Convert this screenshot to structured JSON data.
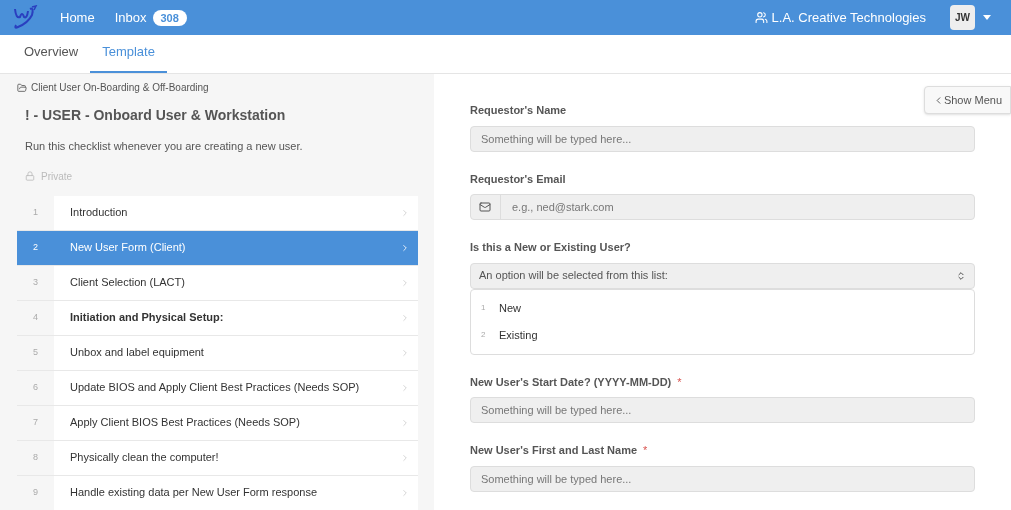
{
  "nav": {
    "links": [
      {
        "label": "Home"
      },
      {
        "label": "Inbox",
        "badge": "308"
      }
    ],
    "org": "L.A. Creative Technologies",
    "avatar": "JW"
  },
  "tabs": [
    {
      "label": "Overview",
      "selected": false
    },
    {
      "label": "Template",
      "selected": true
    }
  ],
  "breadcrumb": "Client User On-Boarding & Off-Boarding",
  "title": "! - USER - Onboard User & Workstation",
  "description": "Run this checklist whenever you are creating a new user.",
  "visibility": "Private",
  "tasks": [
    {
      "number": "1",
      "label": "Introduction",
      "selected": false,
      "heading": false
    },
    {
      "number": "2",
      "label": "New User Form (Client)",
      "selected": true,
      "heading": false
    },
    {
      "number": "3",
      "label": "Client Selection (LACT)",
      "selected": false,
      "heading": false
    },
    {
      "number": "4",
      "label": "Initiation and Physical Setup:",
      "selected": false,
      "heading": true
    },
    {
      "number": "5",
      "label": "Unbox and label equipment",
      "selected": false,
      "heading": false
    },
    {
      "number": "6",
      "label": "Update BIOS and Apply Client Best Practices (Needs SOP)",
      "selected": false,
      "heading": false
    },
    {
      "number": "7",
      "label": "Apply Client BIOS Best Practices (Needs SOP)",
      "selected": false,
      "heading": false
    },
    {
      "number": "8",
      "label": "Physically clean the computer!",
      "selected": false,
      "heading": false
    },
    {
      "number": "9",
      "label": "Handle existing data per New User Form response",
      "selected": false,
      "heading": false
    }
  ],
  "show_menu": "Show Menu",
  "required_mark": "*",
  "form": [
    {
      "kind": "text",
      "label": "Requestor's Name",
      "required": false,
      "placeholder": "Something will be typed here..."
    },
    {
      "kind": "email",
      "label": "Requestor's Email",
      "required": false,
      "placeholder": "e.g., ned@stark.com"
    },
    {
      "kind": "select",
      "label": "Is this a New or Existing User?",
      "required": false,
      "placeholder": "An option will be selected from this list:",
      "options": [
        {
          "number": "1",
          "label": "New"
        },
        {
          "number": "2",
          "label": "Existing"
        }
      ]
    },
    {
      "kind": "text",
      "label": "New User's Start Date? (YYYY-MM-DD)",
      "required": true,
      "placeholder": "Something will be typed here..."
    },
    {
      "kind": "text",
      "label": "New User's First and Last Name",
      "required": true,
      "placeholder": "Something will be typed here..."
    }
  ]
}
